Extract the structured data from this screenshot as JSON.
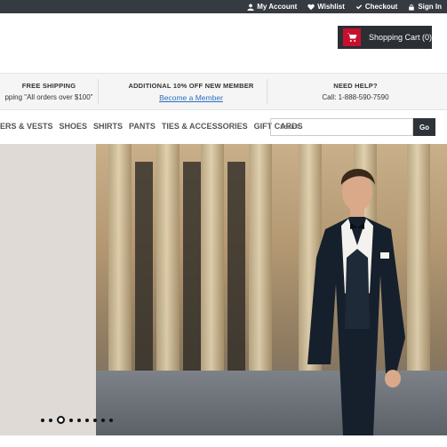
{
  "topbar": {
    "links": [
      {
        "label": "My Account",
        "icon": "user-icon"
      },
      {
        "label": "Wishlist",
        "icon": "heart-icon"
      },
      {
        "label": "Checkout",
        "icon": "check-icon"
      },
      {
        "label": "Sign In",
        "icon": "lock-icon"
      }
    ]
  },
  "cart": {
    "label": "Shopping Cart (0)",
    "icon": "cart-icon",
    "accent": "#c8102e"
  },
  "promo": {
    "shipping_title": "FREE SHIPPING",
    "shipping_sub": "pping \"All orders over $100\"",
    "member_title": "ADDITIONAL 10% OFF NEW MEMBER",
    "member_link": "Become a Member",
    "help_title": "NEED HELP?",
    "help_phone": "Call: 1-888-590-7590"
  },
  "nav": {
    "items": [
      "ERS & VESTS",
      "SHOES",
      "SHIRTS",
      "PANTS",
      "TIES & ACCESSORIES",
      "GIFT CARDS"
    ]
  },
  "search": {
    "placeholder": "Search",
    "button": "Go"
  },
  "carousel": {
    "slides": 9,
    "active": 3
  }
}
